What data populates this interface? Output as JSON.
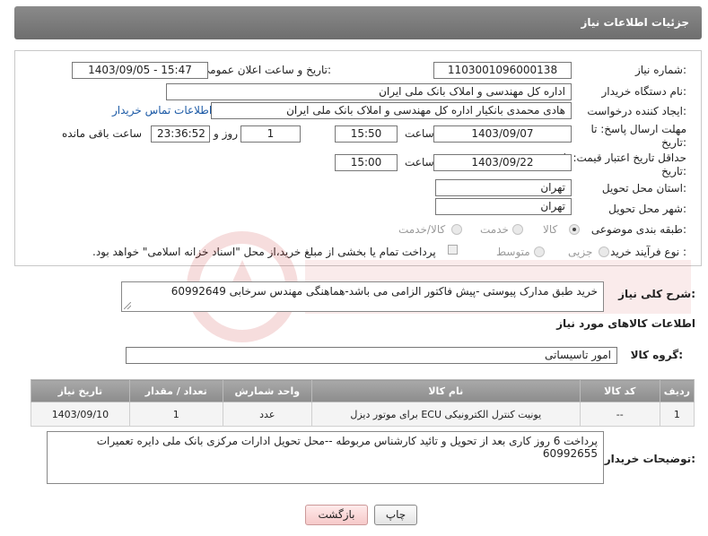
{
  "header": {
    "title": "جزئیات اطلاعات نیاز"
  },
  "form": {
    "need_number": {
      "label": "شماره نیاز:",
      "value": "1103001096000138"
    },
    "announce_datetime": {
      "label": "تاریخ و ساعت اعلان عمومی:",
      "value": "1403/09/05 - 15:47"
    },
    "buyer_org": {
      "label": "نام دستگاه خریدار:",
      "value": "اداره کل مهندسی و املاک بانک ملی ایران"
    },
    "requester": {
      "label": "ایجاد کننده درخواست:",
      "value": "هادی محمدی بانکیار اداره کل مهندسی و املاک بانک ملی ایران"
    },
    "buyer_contact_link": "اطلاعات تماس خریدار",
    "reply_deadline": {
      "label_line1": "مهلت ارسال پاسخ: تا",
      "label_line2": "تاریخ:",
      "date": "1403/09/07",
      "time_label": "ساعت",
      "time": "15:50",
      "days": "1",
      "days_label": "روز و",
      "remaining": "23:36:52",
      "remaining_label": "ساعت باقی مانده"
    },
    "price_validity": {
      "label_line1": "حداقل تاریخ اعتبار قیمت: تا",
      "label_line2": "تاریخ:",
      "date": "1403/09/22",
      "time_label": "ساعت",
      "time": "15:00"
    },
    "delivery_province": {
      "label": "استان محل تحویل:",
      "value": "تهران"
    },
    "delivery_city": {
      "label": "شهر محل تحویل:",
      "value": "تهران"
    },
    "category": {
      "label": "طبقه بندی موضوعی:",
      "options": [
        "کالا",
        "خدمت",
        "کالا/خدمت"
      ],
      "selected": "کالا"
    },
    "purchase_process": {
      "label": "نوع فرآیند خرید :",
      "options": [
        "جزیی",
        "متوسط"
      ],
      "checkbox_text": "پرداخت تمام یا بخشی از مبلغ خرید،از محل \"اسناد خزانه اسلامی\" خواهد بود."
    }
  },
  "description": {
    "label": "شرح کلی نیاز:",
    "value": "خرید طبق مدارک پیوستی -پیش فاکتور الزامی می باشد-هماهنگی مهندس سرخابی 60992649"
  },
  "goods_info": {
    "title": "اطلاعات کالاهای مورد نیاز",
    "group_label": "گروه کالا:",
    "group_value": "امور تاسیساتی"
  },
  "table": {
    "headers": [
      "ردیف",
      "کد کالا",
      "نام کالا",
      "واحد شمارش",
      "تعداد / مقدار",
      "تاریخ نیاز"
    ],
    "rows": [
      [
        "1",
        "--",
        "یونیت کنترل الکترونیکی ECU برای موتور دیزل",
        "عدد",
        "1",
        "1403/09/10"
      ]
    ]
  },
  "buyer_notes": {
    "label": "توضیحات خریدار:",
    "value": "پرداخت 6 روز کاری بعد از تحویل و تائید کارشناس مربوطه --محل تحویل ادارات مرکزی بانک ملی دایره تعمیرات 60992655"
  },
  "buttons": {
    "print": "چاپ",
    "back": "بازگشت"
  },
  "colors": {
    "header_bg": "#7a7a7a",
    "link": "#1c5aa6",
    "back_button": "#f6c9c9"
  }
}
